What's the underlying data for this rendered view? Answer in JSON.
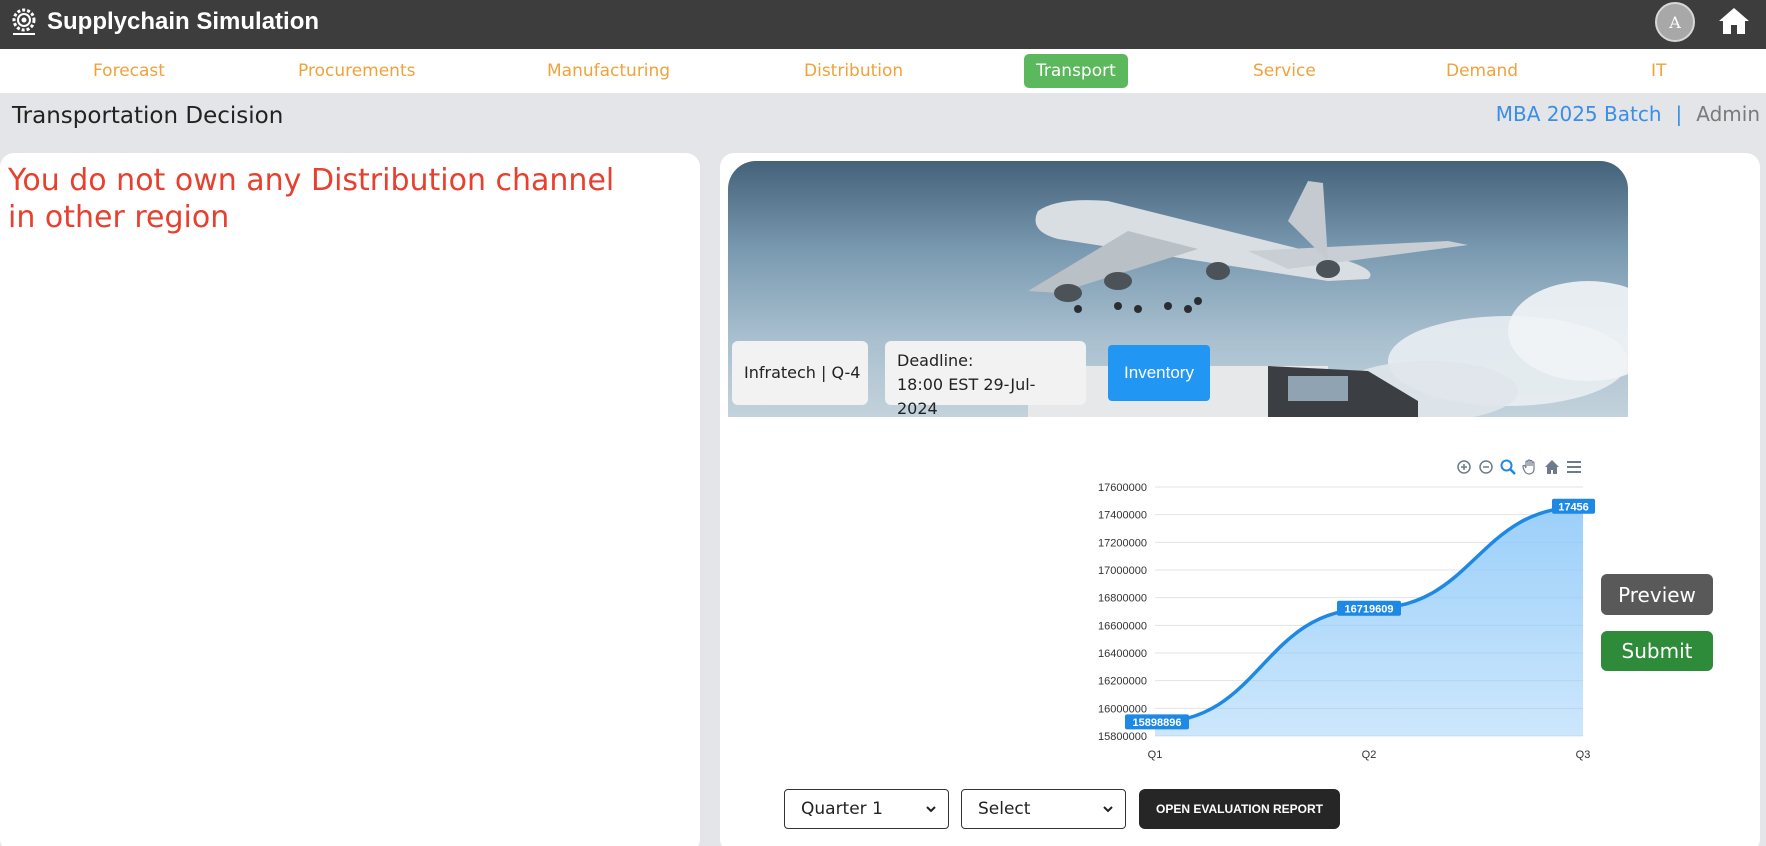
{
  "app": {
    "title": "Supplychain Simulation",
    "avatar_initial": "A"
  },
  "nav": {
    "items": [
      "Forecast",
      "Procurements",
      "Manufacturing",
      "Distribution",
      "Transport",
      "Service",
      "Demand",
      "IT"
    ],
    "active": "Transport"
  },
  "page": {
    "title": "Transportation Decision",
    "batch": "MBA 2025 Batch",
    "separator": "|",
    "role": "Admin"
  },
  "notice": "You do not own any Distribution channel in other region",
  "banner": {
    "company": "Infratech | Q-4",
    "deadline_label": "Deadline:",
    "deadline_value": "18:00 EST 29-Jul-2024",
    "inventory_label": "Inventory"
  },
  "chart_data": {
    "type": "area",
    "categories": [
      "Q1",
      "Q2",
      "Q3"
    ],
    "values": [
      15898896,
      16719609,
      17456900
    ],
    "data_labels": [
      "15898896",
      "16719609",
      "17456"
    ],
    "ylim": [
      15800000,
      17600000
    ],
    "yticks": [
      "15800000",
      "16000000",
      "16200000",
      "16400000",
      "16600000",
      "16800000",
      "17000000",
      "17200000",
      "17400000",
      "17600000"
    ],
    "grid": true,
    "colors": {
      "line": "#1e88e5",
      "fill": "#90caf9"
    }
  },
  "actions": {
    "preview": "Preview",
    "submit": "Submit"
  },
  "filters": {
    "quarter": "Quarter 1",
    "select": "Select",
    "report_button": "OPEN EVALUATION REPORT"
  }
}
